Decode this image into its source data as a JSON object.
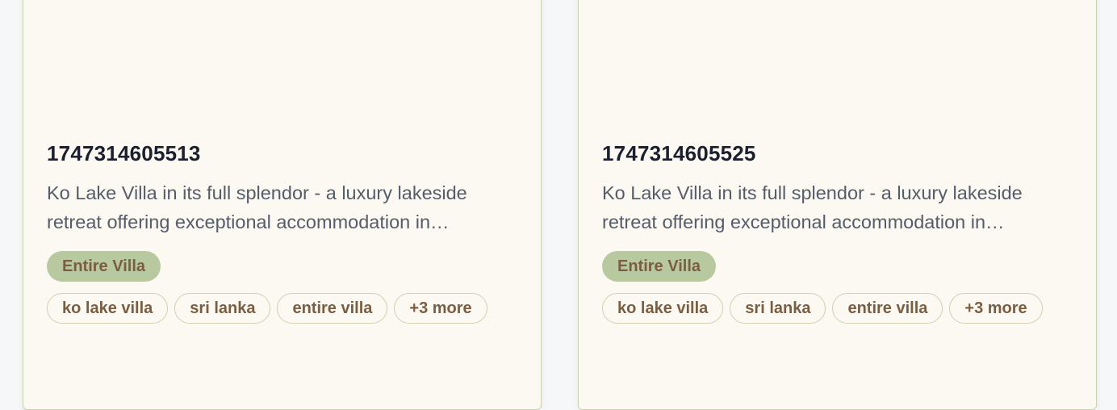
{
  "cards": [
    {
      "title": "1747314605513",
      "description": "Ko Lake Villa in its full splendor - a luxury lakeside retreat offering exceptional accommodation in…",
      "type": "Entire Villa",
      "tags": [
        "ko lake villa",
        "sri lanka",
        "entire villa",
        "+3 more"
      ]
    },
    {
      "title": "1747314605525",
      "description": "Ko Lake Villa in its full splendor - a luxury lakeside retreat offering exceptional accommodation in…",
      "type": "Entire Villa",
      "tags": [
        "ko lake villa",
        "sri lanka",
        "entire villa",
        "+3 more"
      ]
    }
  ],
  "colors": {
    "card_bg": "#fcf8f2",
    "badge_bg": "#b8c99f",
    "badge_text": "#7a5e42",
    "title_text": "#1b1f2e",
    "desc_text": "#555c6a"
  }
}
